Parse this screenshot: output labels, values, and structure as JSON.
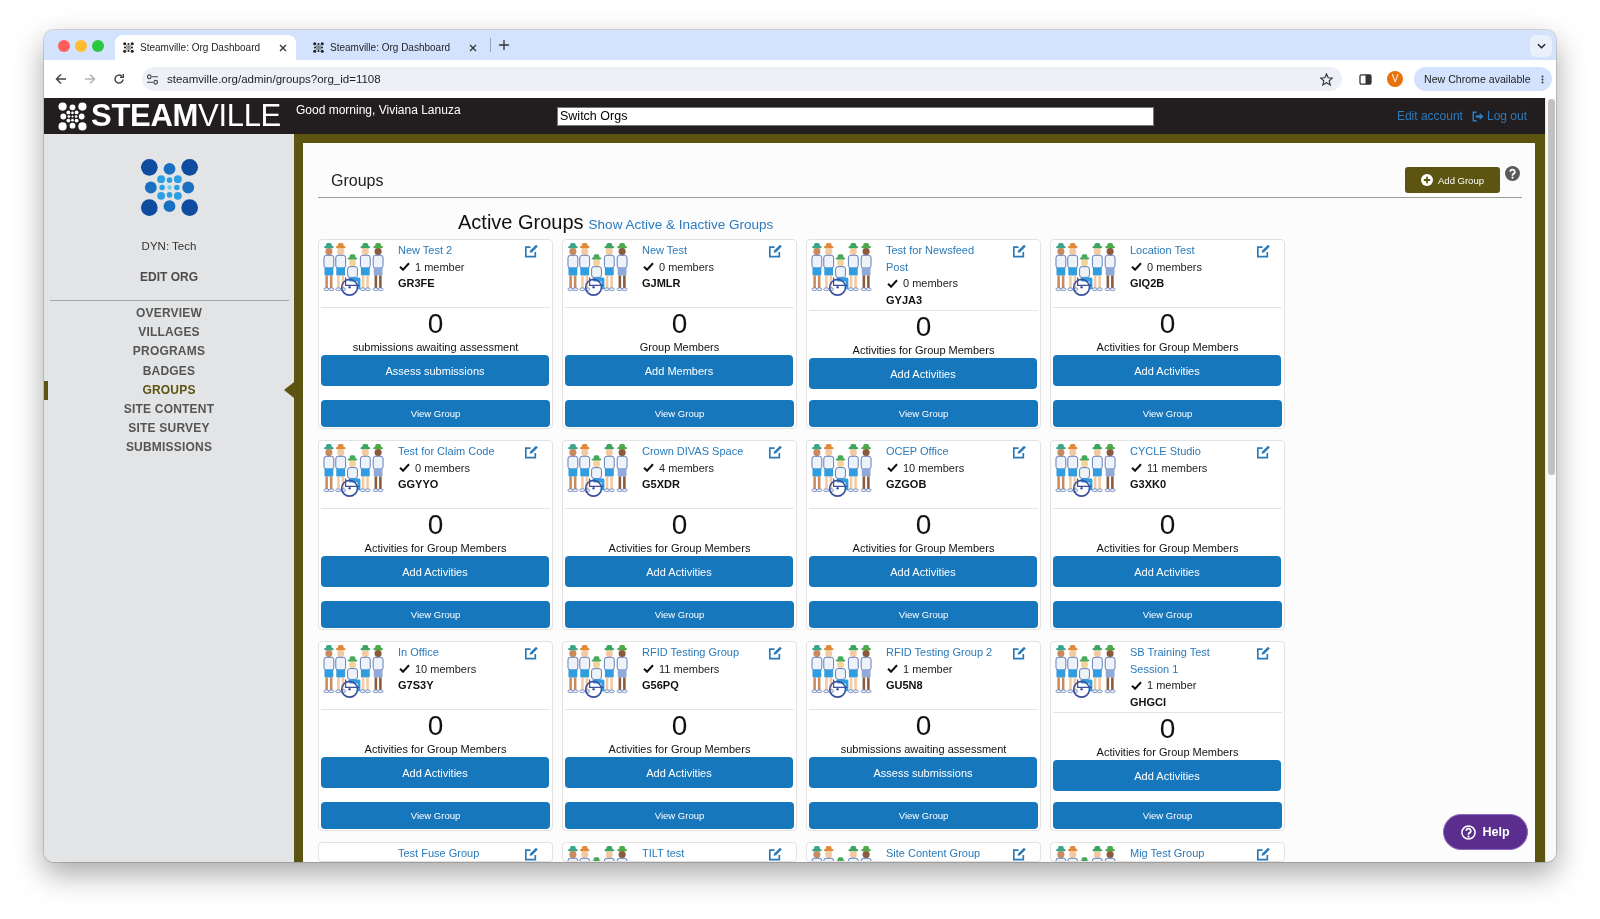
{
  "browser": {
    "tabs": [
      {
        "title": "Steamville: Org Dashboard",
        "selected": true
      },
      {
        "title": "Steamville: Org Dashboard",
        "selected": false
      }
    ],
    "nav": [
      {
        "kind": "back",
        "disabled": false
      },
      {
        "kind": "forward",
        "disabled": true
      },
      {
        "kind": "reload",
        "disabled": false
      }
    ],
    "url": "steamville.org/admin/groups?org_id=1108",
    "profile_initial": "V",
    "update_button": "New Chrome available"
  },
  "header": {
    "brand": "**STEAM**VILLE",
    "greeting": "Good morning, Viviana Lanuza",
    "org_switcher": {
      "value": "Switch Orgs"
    },
    "links": [
      {
        "label": "Edit account",
        "kind": "account"
      },
      {
        "label": "Log out",
        "kind": "logout"
      }
    ]
  },
  "sidebar": {
    "org_name": "DYN: Tech",
    "edit_link": "EDIT ORG",
    "items": [
      {
        "label": "OVERVIEW",
        "selected": false
      },
      {
        "label": "VILLAGES",
        "selected": false
      },
      {
        "label": "PROGRAMS",
        "selected": false
      },
      {
        "label": "BADGES",
        "selected": false
      },
      {
        "label": "GROUPS",
        "selected": true
      },
      {
        "label": "SITE CONTENT",
        "selected": false
      },
      {
        "label": "SITE SURVEY",
        "selected": false
      },
      {
        "label": "SUBMISSIONS",
        "selected": false
      }
    ]
  },
  "main": {
    "title": "Groups",
    "add_button": "Add Group",
    "section_title": "Active Groups",
    "toggle_link": "Show Active & Inactive Groups",
    "groups": [
      {
        "name": "New Test 2",
        "picture": true,
        "members": "1 member",
        "code": "GR3FE",
        "count": "0",
        "count_label": "submissions awaiting assessment",
        "action": "Assess submissions",
        "view": "View Group"
      },
      {
        "name": "New Test",
        "picture": true,
        "members": "0 members",
        "code": "GJMLR",
        "count": "0",
        "count_label": "Group Members",
        "action": "Add Members",
        "view": "View Group"
      },
      {
        "name": "Test for Newsfeed Post",
        "picture": true,
        "members": "0 members",
        "code": "GYJA3",
        "count": "0",
        "count_label": "Activities for Group Members",
        "action": "Add Activities",
        "view": "View Group"
      },
      {
        "name": "Location Test",
        "picture": true,
        "members": "0 members",
        "code": "GIQ2B",
        "count": "0",
        "count_label": "Activities for Group Members",
        "action": "Add Activities",
        "view": "View Group"
      },
      {
        "name": "Test for Claim Code",
        "picture": true,
        "members": "0 members",
        "code": "GGYYO",
        "count": "0",
        "count_label": "Activities for Group Members",
        "action": "Add Activities",
        "view": "View Group"
      },
      {
        "name": "Crown DIVAS Space",
        "picture": true,
        "members": "4 members",
        "code": "G5XDR",
        "count": "0",
        "count_label": "Activities for Group Members",
        "action": "Add Activities",
        "view": "View Group"
      },
      {
        "name": "OCEP Office",
        "picture": true,
        "members": "10 members",
        "code": "GZGOB",
        "count": "0",
        "count_label": "Activities for Group Members",
        "action": "Add Activities",
        "view": "View Group"
      },
      {
        "name": "CYCLE Studio",
        "picture": true,
        "members": "11 members",
        "code": "G3XK0",
        "count": "0",
        "count_label": "Activities for Group Members",
        "action": "Add Activities",
        "view": "View Group"
      },
      {
        "name": "In Office",
        "picture": true,
        "members": "10 members",
        "code": "G7S3Y",
        "count": "0",
        "count_label": "Activities for Group Members",
        "action": "Add Activities",
        "view": "View Group"
      },
      {
        "name": "RFID Testing Group",
        "picture": true,
        "members": "11 members",
        "code": "G56PQ",
        "count": "0",
        "count_label": "Activities for Group Members",
        "action": "Add Activities",
        "view": "View Group"
      },
      {
        "name": "RFID Testing Group 2",
        "picture": true,
        "members": "1 member",
        "code": "GU5N8",
        "count": "0",
        "count_label": "submissions awaiting assessment",
        "action": "Assess submissions",
        "view": "View Group"
      },
      {
        "name": "SB Training Test Session 1",
        "picture": true,
        "members": "1 member",
        "code": "GHGCI",
        "count": "0",
        "count_label": "Activities for Group Members",
        "action": "Add Activities",
        "view": "View Group"
      },
      {
        "name": "Test Fuse Group",
        "picture": false
      },
      {
        "name": "TILT test",
        "picture": true
      },
      {
        "name": "Site Content Group",
        "picture": true
      },
      {
        "name": "Mig Test Group",
        "picture": true
      }
    ]
  },
  "help_button": "Help"
}
